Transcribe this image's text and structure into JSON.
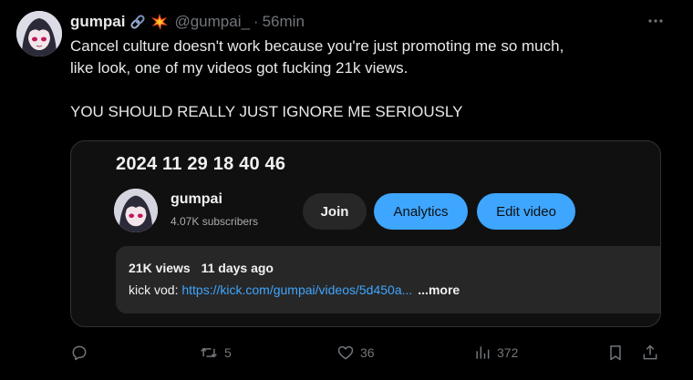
{
  "post": {
    "display_name": "gumpai",
    "handle": "@gumpai_",
    "separator": "·",
    "time": "56min",
    "text_line1": "Cancel culture doesn't work because you're just promoting me so much,",
    "text_line2": "like look, one of my videos got fucking 21k views.",
    "text_line3": "YOU SHOULD REALLY JUST IGNORE ME SERIOUSLY",
    "badges": [
      "link-chain-emoji-icon",
      "collision-spark-emoji-icon"
    ]
  },
  "media": {
    "video_title": "2024 11 29 18 40 46",
    "channel_name": "gumpai",
    "subscribers": "4.07K subscribers",
    "join_label": "Join",
    "analytics_label": "Analytics",
    "edit_label": "Edit video",
    "views": "21K views",
    "age": "11 days ago",
    "desc_prefix": "kick vod: ",
    "desc_link": "https://kick.com/gumpai/videos/5d450a...",
    "desc_more": "...more"
  },
  "actions": {
    "reply_count": "",
    "repost_count": "5",
    "like_count": "36",
    "views_count": "372"
  },
  "colors": {
    "background": "#000000",
    "text": "#e7e9ea",
    "muted": "#71767b",
    "accent_blue": "#3ea6ff",
    "card_bg": "#101010",
    "desc_bg": "#272727"
  }
}
